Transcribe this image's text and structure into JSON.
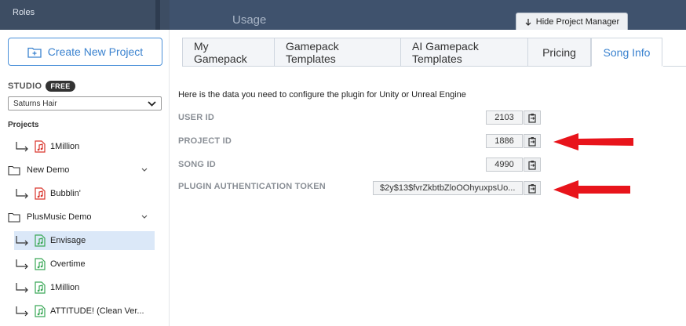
{
  "topbar": {
    "roles_label": "Roles",
    "usage_label": "Usage",
    "hide_button_label": "Hide Project Manager"
  },
  "sidebar": {
    "create_button_label": "Create New Project",
    "studio_label": "STUDIO",
    "plan_badge": "FREE",
    "studio_select_value": "Saturns Hair",
    "projects_label": "Projects",
    "items": [
      {
        "label": "1Million",
        "type": "song",
        "icon_color": "#d9342b"
      },
      {
        "label": "New Demo",
        "type": "folder"
      },
      {
        "label": "Bubblin'",
        "type": "song",
        "icon_color": "#d9342b"
      },
      {
        "label": "PlusMusic Demo",
        "type": "folder"
      },
      {
        "label": "Envisage",
        "type": "song",
        "icon_color": "#3aa857"
      },
      {
        "label": "Overtime",
        "type": "song",
        "icon_color": "#3aa857"
      },
      {
        "label": "1Million",
        "type": "song",
        "icon_color": "#3aa857"
      },
      {
        "label": "ATTITUDE! (Clean Ver...",
        "type": "song",
        "icon_color": "#3aa857"
      }
    ]
  },
  "tabs": [
    {
      "label": "My Gamepack"
    },
    {
      "label": "Gamepack Templates"
    },
    {
      "label": "AI Gamepack Templates"
    },
    {
      "label": "Pricing"
    },
    {
      "label": "Song Info",
      "active": true
    }
  ],
  "content": {
    "intro": "Here is the data you need to configure the plugin for Unity or Unreal Engine",
    "fields": [
      {
        "label": "USER ID",
        "value": "2103"
      },
      {
        "label": "PROJECT ID",
        "value": "1886"
      },
      {
        "label": "SONG ID",
        "value": "4990"
      },
      {
        "label": "PLUGIN AUTHENTICATION TOKEN",
        "value": "$2y$13$fvrZkbtbZloOOhyuxpsUo..."
      }
    ]
  },
  "colors": {
    "accent": "#3a82cf",
    "annotation_arrow": "#e8141b"
  }
}
